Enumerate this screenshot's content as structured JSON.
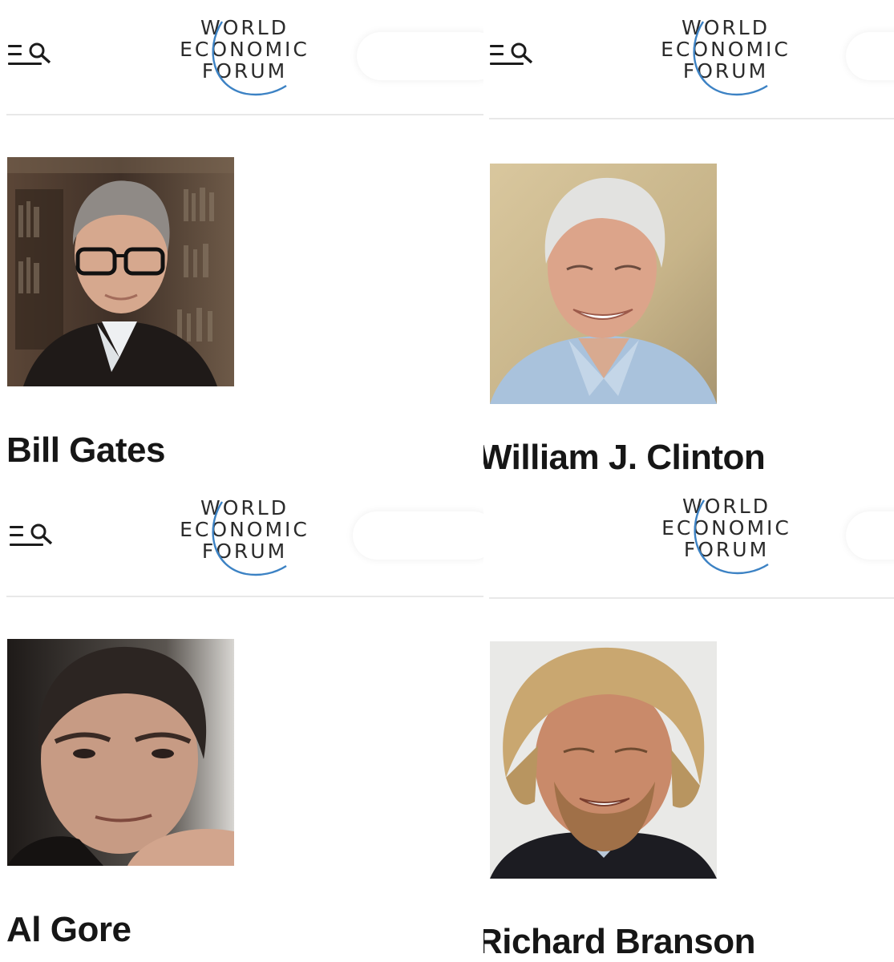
{
  "header": {
    "logo_lines": [
      "WORLD",
      "ECONOMIC",
      "FORUM"
    ],
    "brand_arc_color": "#3c82c4",
    "menu_icon": "menu-search-icon"
  },
  "profiles": [
    {
      "name": "Bill Gates"
    },
    {
      "name": "William J. Clinton"
    },
    {
      "name": "Al Gore"
    },
    {
      "name": "Richard Branson"
    }
  ]
}
